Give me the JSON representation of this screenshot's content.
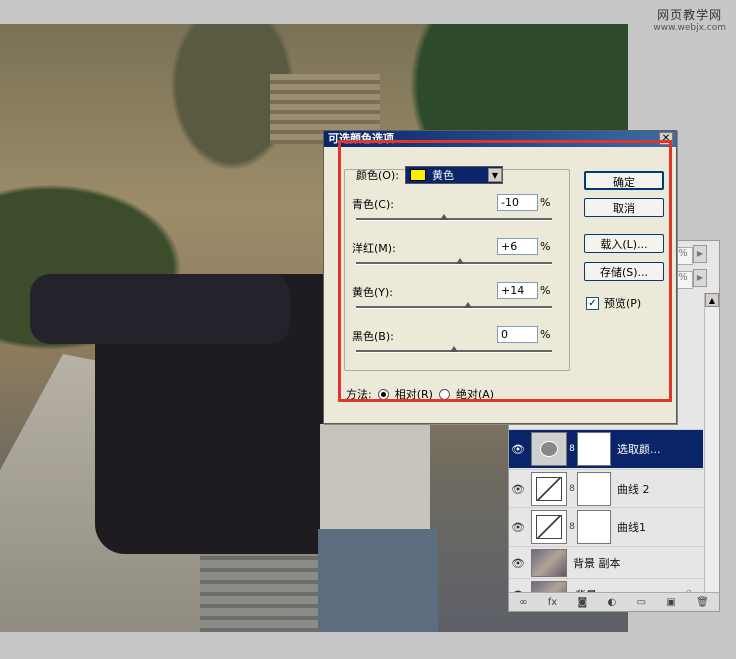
{
  "watermark": {
    "line1": "网页教学网",
    "line2": "www.webjx.com"
  },
  "dialog": {
    "title": "可选颜色选项",
    "close": "✕",
    "colors_label": "颜色(O):",
    "colors_value": "黄色",
    "sliders": [
      {
        "label": "青色(C):",
        "value": "-10",
        "unit": "%",
        "level": 0.45
      },
      {
        "label": "洋红(M):",
        "value": "+6",
        "unit": "%",
        "level": 0.53
      },
      {
        "label": "黄色(Y):",
        "value": "+14",
        "unit": "%",
        "level": 0.57
      },
      {
        "label": "黑色(B):",
        "value": "0",
        "unit": "%",
        "level": 0.5
      }
    ],
    "method_label": "方法:",
    "method_relative": "相对(R)",
    "method_absolute": "绝对(A)",
    "buttons": {
      "ok": "确定",
      "cancel": "取消",
      "load": "载入(L)...",
      "save": "存储(S)..."
    },
    "preview_label": "预览(P)",
    "preview_checked": "✓",
    "accent_color": "#e0352a"
  },
  "layers": {
    "pct1": "%",
    "pct2": "%",
    "rows": [
      {
        "name": "选取颜...",
        "selected": true
      },
      {
        "name": "曲线 2"
      },
      {
        "name": "曲线1"
      },
      {
        "name": "背景 副本"
      },
      {
        "name": "背景"
      }
    ],
    "eye": "👁",
    "chain": "8",
    "lock": "🔒"
  }
}
